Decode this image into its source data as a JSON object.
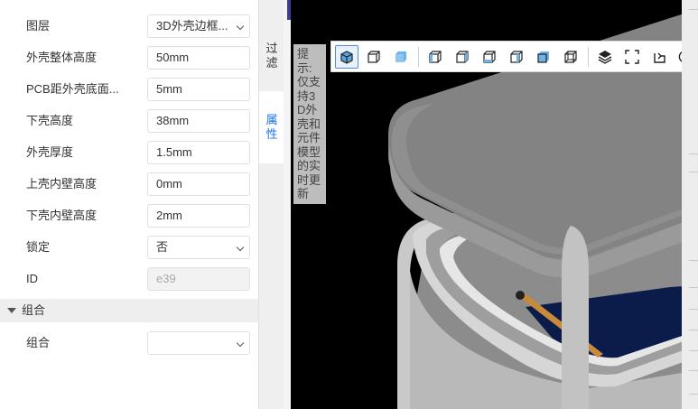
{
  "properties": {
    "rows": [
      {
        "label": "图层",
        "value": "3D外壳边框...",
        "type": "select"
      },
      {
        "label": "外壳整体高度",
        "value": "50mm",
        "type": "input"
      },
      {
        "label": "PCB距外壳底面...",
        "value": "5mm",
        "type": "input"
      },
      {
        "label": "下壳高度",
        "value": "38mm",
        "type": "input"
      },
      {
        "label": "外壳厚度",
        "value": "1.5mm",
        "type": "input"
      },
      {
        "label": "上壳内壁高度",
        "value": "0mm",
        "type": "input"
      },
      {
        "label": "下壳内壁高度",
        "value": "2mm",
        "type": "input"
      },
      {
        "label": "锁定",
        "value": "否",
        "type": "select"
      },
      {
        "label": "ID",
        "value": "e39",
        "type": "disabled"
      }
    ],
    "group": {
      "header": "组合",
      "row_label": "组合",
      "row_value": ""
    }
  },
  "tabs": {
    "filter": [
      "过",
      "滤"
    ],
    "attribute": [
      "属",
      "性"
    ]
  },
  "viewport": {
    "hint_text": "提示:仅支持3D外壳和元件模型的实时更新",
    "toolbar_icons": [
      "cube-view-icon",
      "cube-front-icon",
      "cube-solid-icon",
      "cube-left-icon",
      "cube-right-icon",
      "cube-top-icon",
      "cube-bottom-icon",
      "cube-back-icon",
      "cube-iso-icon",
      "layers-icon",
      "fullscreen-icon",
      "rotate-icon",
      "refresh-icon"
    ]
  },
  "colors": {
    "accent": "#1a73e8",
    "shell": "#8a8a8a",
    "board": "#0b1c4a",
    "trace": "#c8893a"
  }
}
